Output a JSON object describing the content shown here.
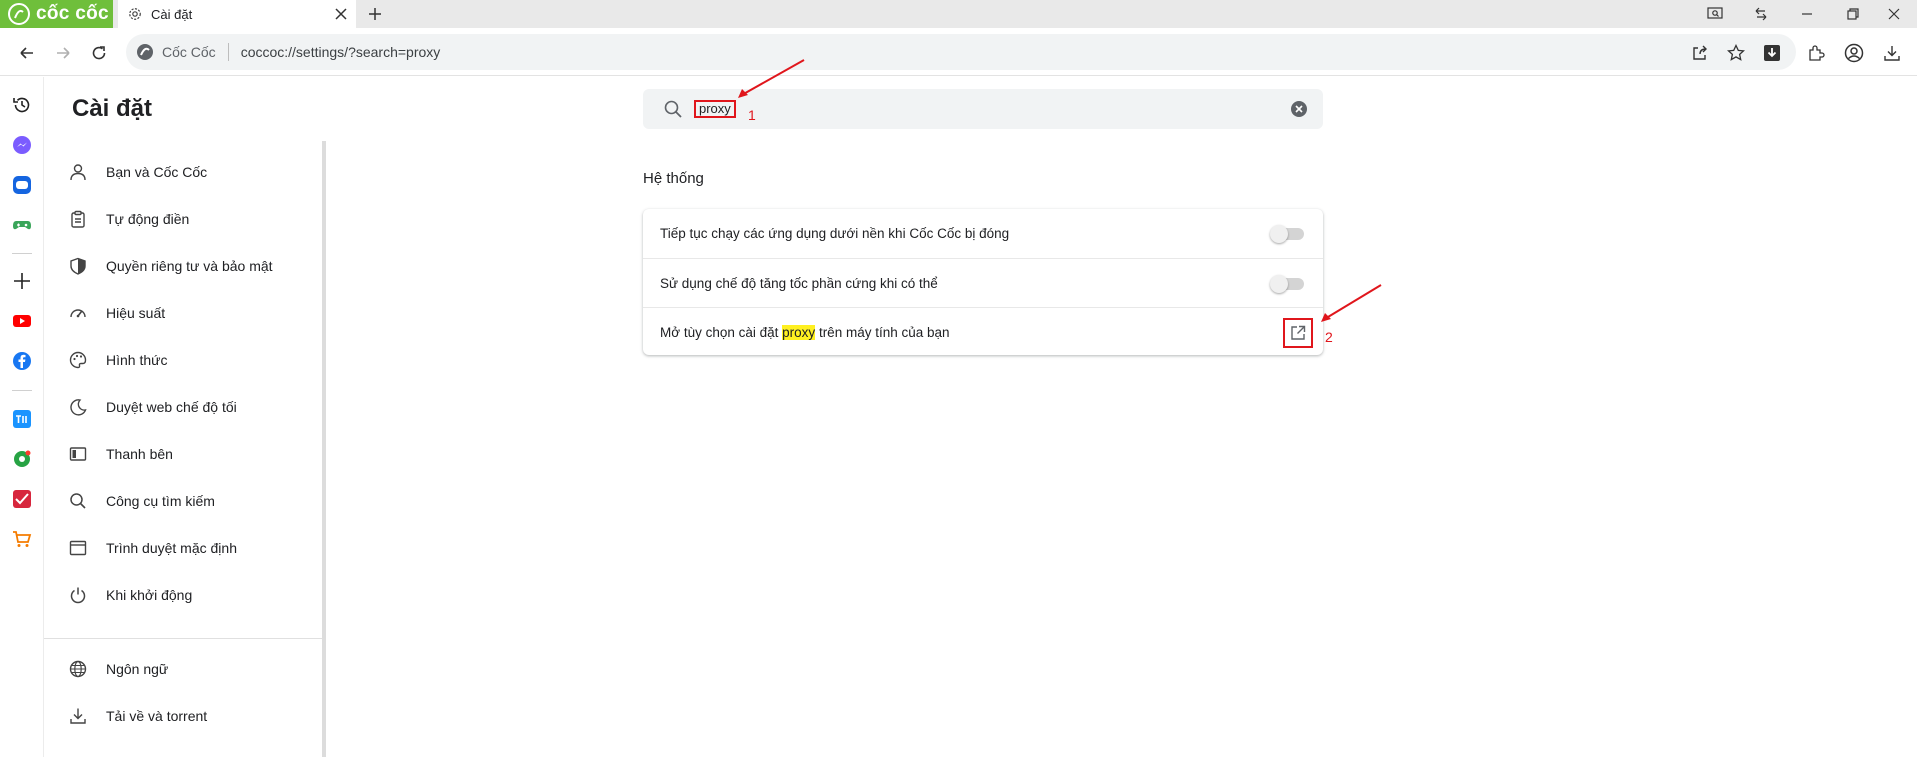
{
  "brand": {
    "name": "cốc cốc"
  },
  "tab": {
    "title": "Cài đặt"
  },
  "address": {
    "site_label": "Cốc Cốc",
    "url": "coccoc://settings/?search=proxy"
  },
  "settings": {
    "title": "Cài đặt",
    "nav": [
      {
        "label": "Bạn và Cốc Cốc",
        "icon": "person-icon"
      },
      {
        "label": "Tự động điền",
        "icon": "clipboard-icon"
      },
      {
        "label": "Quyền riêng tư và bảo mật",
        "icon": "shield-icon"
      },
      {
        "label": "Hiệu suất",
        "icon": "speedometer-icon"
      },
      {
        "label": "Hình thức",
        "icon": "palette-icon"
      },
      {
        "label": "Duyệt web chế độ tối",
        "icon": "moon-icon"
      },
      {
        "label": "Thanh bên",
        "icon": "sidebar-icon"
      },
      {
        "label": "Công cụ tìm kiếm",
        "icon": "search-icon"
      },
      {
        "label": "Trình duyệt mặc định",
        "icon": "browser-window-icon"
      },
      {
        "label": "Khi khởi động",
        "icon": "power-icon"
      },
      {
        "label": "Ngôn ngữ",
        "icon": "globe-icon"
      },
      {
        "label": "Tải về và torrent",
        "icon": "download-icon"
      }
    ]
  },
  "search": {
    "query": "proxy"
  },
  "annotations": {
    "one": "1",
    "two": "2"
  },
  "section": {
    "title": "Hệ thống",
    "rows": [
      {
        "label": "Tiếp tục chạy các ứng dụng dưới nền khi Cốc Cốc bị đóng"
      },
      {
        "label": "Sử dụng chế độ tăng tốc phần cứng khi có thể"
      },
      {
        "label_before": "Mở tùy chọn cài đặt ",
        "label_highlight": "proxy",
        "label_after": " trên máy tính của bạn"
      }
    ]
  },
  "colors": {
    "brand": "#6fbf3b",
    "annotation": "#e0161c",
    "highlight": "#fff021"
  }
}
